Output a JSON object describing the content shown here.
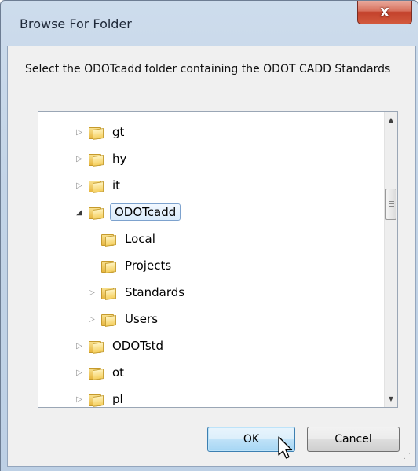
{
  "window": {
    "title": "Browse For Folder",
    "close_label": "X"
  },
  "prompt": "Select the ODOTcadd folder containing the ODOT CADD Standards",
  "tree": {
    "nodes": [
      {
        "label": "gt",
        "level": 0,
        "expander": "collapsed",
        "selected": false
      },
      {
        "label": "hy",
        "level": 0,
        "expander": "collapsed",
        "selected": false
      },
      {
        "label": "it",
        "level": 0,
        "expander": "collapsed",
        "selected": false
      },
      {
        "label": "ODOTcadd",
        "level": 0,
        "expander": "expanded",
        "selected": true
      },
      {
        "label": "Local",
        "level": 1,
        "expander": "none",
        "selected": false
      },
      {
        "label": "Projects",
        "level": 1,
        "expander": "none",
        "selected": false
      },
      {
        "label": "Standards",
        "level": 1,
        "expander": "collapsed",
        "selected": false
      },
      {
        "label": "Users",
        "level": 1,
        "expander": "collapsed",
        "selected": false
      },
      {
        "label": "ODOTstd",
        "level": 0,
        "expander": "collapsed",
        "selected": false
      },
      {
        "label": "ot",
        "level": 0,
        "expander": "collapsed",
        "selected": false
      },
      {
        "label": "pl",
        "level": 0,
        "expander": "collapsed",
        "selected": false
      }
    ],
    "icon": "folder-icon"
  },
  "buttons": {
    "ok_label": "OK",
    "cancel_label": "Cancel"
  },
  "colors": {
    "selection_border": "#7da2ce",
    "default_button_border": "#3c7fb1",
    "close_button": "#c3412b"
  }
}
